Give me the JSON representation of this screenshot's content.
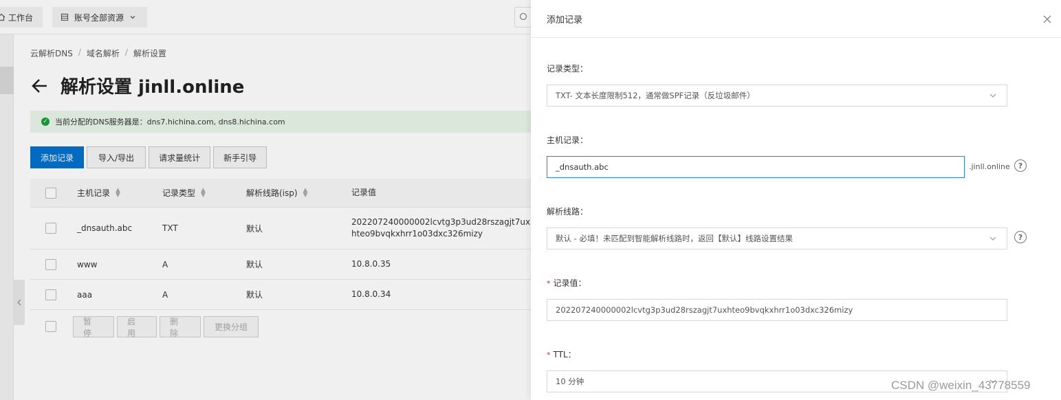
{
  "topbar": {
    "workbench_label": "工作台",
    "resources_label": "账号全部资源"
  },
  "breadcrumb": [
    "云解析DNS",
    "域名解析",
    "解析设置"
  ],
  "page": {
    "title": "解析设置 jinll.online",
    "dns_notice": "当前分配的DNS服务器是：dns7.hichina.com, dns8.hichina.com"
  },
  "toolbar": {
    "add_record": "添加记录",
    "import_export": "导入/导出",
    "request_stats": "请求量统计",
    "guide": "新手引导"
  },
  "table": {
    "columns": [
      "主机记录",
      "记录类型",
      "解析线路(isp)",
      "记录值"
    ],
    "rows": [
      {
        "host": "_dnsauth.abc",
        "type": "TXT",
        "line": "默认",
        "value": "202207240000002lcvtg3p3ud28rszagjt7uxhteo9bvqkxhrr1o03dxc326mizy"
      },
      {
        "host": "www",
        "type": "A",
        "line": "默认",
        "value": "10.8.0.35"
      },
      {
        "host": "aaa",
        "type": "A",
        "line": "默认",
        "value": "10.8.0.34"
      }
    ],
    "bulk_actions": {
      "pause": "暂停",
      "enable": "启用",
      "delete": "删除",
      "change_group": "更换分组"
    }
  },
  "drawer": {
    "title": "添加记录",
    "record_type_label": "记录类型：",
    "record_type_value": "TXT- 文本长度限制512，通常做SPF记录（反垃圾邮件）",
    "host_label": "主机记录：",
    "host_value": "_dnsauth.abc",
    "host_suffix": ".jinll.online",
    "line_label": "解析线路：",
    "line_value": "默认 - 必填！未匹配到智能解析线路时，返回【默认】线路设置结果",
    "value_label": "记录值：",
    "value_value": "202207240000002lcvtg3p3ud28rszagjt7uxhteo9bvqkxhrr1o03dxc326mizy",
    "ttl_label": "TTL：",
    "ttl_value": "10 分钟",
    "required_mark": "*"
  },
  "watermark": "CSDN @weixin_43778559",
  "colors": {
    "primary": "#0070cc",
    "focus_border": "#2e7de0",
    "success": "#1a9e3c",
    "required": "#d93026"
  }
}
